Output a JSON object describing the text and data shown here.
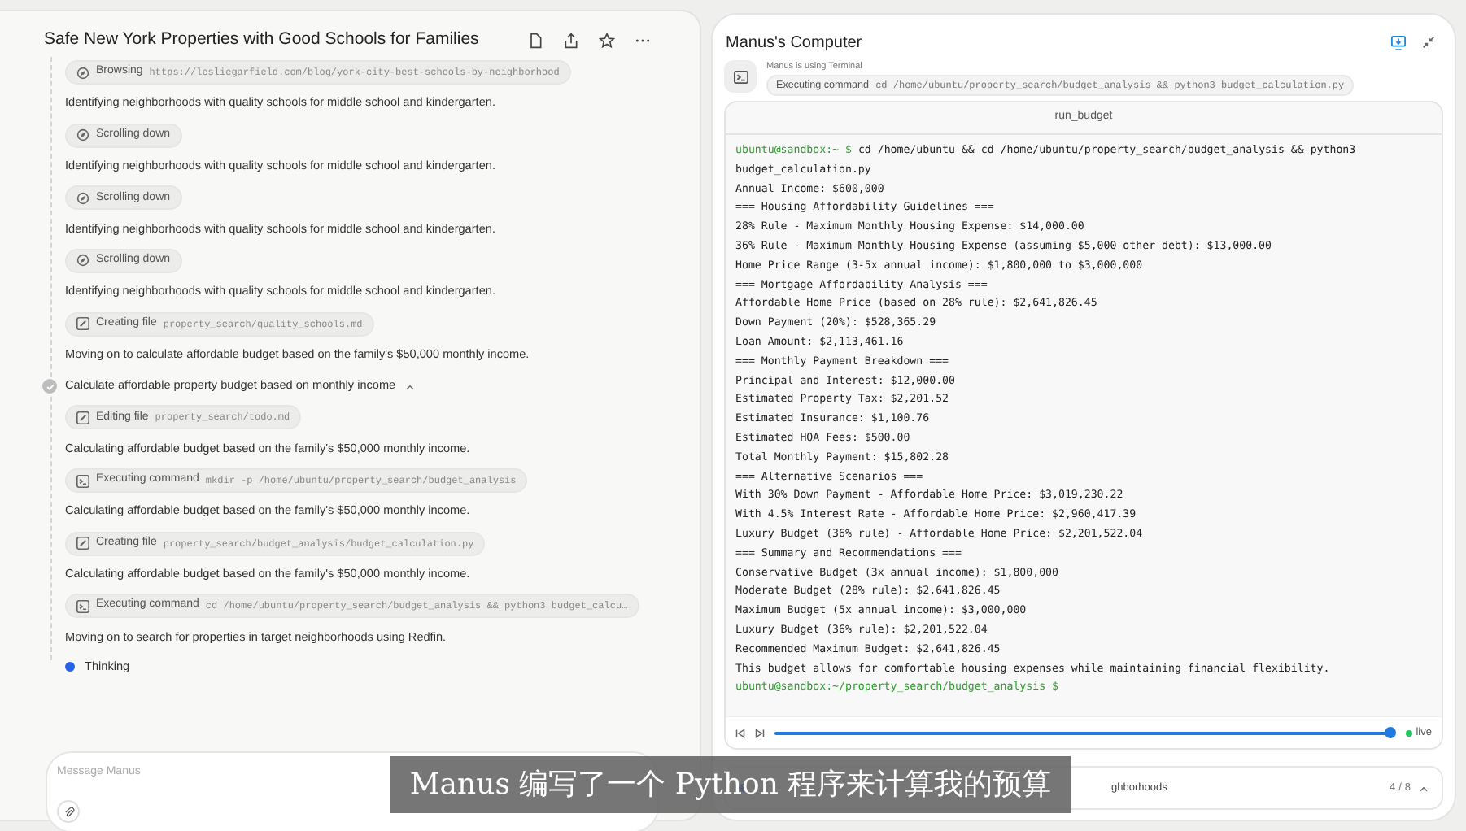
{
  "chat": {
    "title": "Safe New York Properties with Good Schools for Families",
    "log": [
      {
        "kind": "browser_chip",
        "label": "Browsing",
        "detail": "https://lesliegarfield.com/blog/york-city-best-schools-by-neighborhood"
      },
      {
        "kind": "text",
        "text": "Identifying neighborhoods with quality schools for middle school and kindergarten."
      },
      {
        "kind": "browser_chip",
        "label": "Scrolling down"
      },
      {
        "kind": "text",
        "text": "Identifying neighborhoods with quality schools for middle school and kindergarten."
      },
      {
        "kind": "browser_chip",
        "label": "Scrolling down"
      },
      {
        "kind": "text",
        "text": "Identifying neighborhoods with quality schools for middle school and kindergarten."
      },
      {
        "kind": "browser_chip",
        "label": "Scrolling down"
      },
      {
        "kind": "text",
        "text": "Identifying neighborhoods with quality schools for middle school and kindergarten."
      },
      {
        "kind": "file_chip",
        "label": "Creating file",
        "detail": "property_search/quality_schools.md"
      },
      {
        "kind": "text",
        "text": "Moving on to calculate affordable budget based on the family's $50,000 monthly income."
      },
      {
        "kind": "step",
        "text": "Calculate affordable property budget based on monthly income",
        "done": true,
        "expanded": true
      },
      {
        "kind": "file_chip",
        "label": "Editing file",
        "detail": "property_search/todo.md"
      },
      {
        "kind": "text",
        "text": "Calculating affordable budget based on the family's $50,000 monthly income."
      },
      {
        "kind": "terminal_chip",
        "label": "Executing command",
        "detail": "mkdir -p /home/ubuntu/property_search/budget_analysis"
      },
      {
        "kind": "text",
        "text": "Calculating affordable budget based on the family's $50,000 monthly income."
      },
      {
        "kind": "file_chip",
        "label": "Creating file",
        "detail": "property_search/budget_analysis/budget_calculation.py"
      },
      {
        "kind": "text",
        "text": "Calculating affordable budget based on the family's $50,000 monthly income."
      },
      {
        "kind": "terminal_chip",
        "label": "Executing command",
        "detail": "cd /home/ubuntu/property_search/budget_analysis && python3 budget_calcu…"
      },
      {
        "kind": "text",
        "text": "Moving on to search for properties in target neighborhoods using Redfin."
      },
      {
        "kind": "thinking",
        "text": "Thinking"
      }
    ],
    "input": {
      "placeholder": "Message Manus"
    }
  },
  "computer": {
    "title": "Manus's Computer",
    "status": "Manus is using Terminal",
    "action": {
      "label": "Executing command",
      "detail": "cd /home/ubuntu/property_search/budget_analysis && python3 budget_calculation.py"
    },
    "terminal": {
      "title": "run_budget",
      "lines": [
        {
          "kind": "prompt",
          "prompt": "ubuntu@sandbox:~ $",
          "command": "cd /home/ubuntu && cd /home/ubuntu/property_search/budget_analysis && python3 budget_calculation.py"
        },
        {
          "kind": "output",
          "text": "Annual Income: $600,000"
        },
        {
          "kind": "output",
          "text": "=== Housing Affordability Guidelines ==="
        },
        {
          "kind": "output",
          "text": "28% Rule - Maximum Monthly Housing Expense: $14,000.00"
        },
        {
          "kind": "output",
          "text": "36% Rule - Maximum Monthly Housing Expense (assuming $5,000 other debt): $13,000.00"
        },
        {
          "kind": "output",
          "text": "Home Price Range (3-5x annual income): $1,800,000 to $3,000,000"
        },
        {
          "kind": "output",
          "text": "=== Mortgage Affordability Analysis ==="
        },
        {
          "kind": "output",
          "text": "Affordable Home Price (based on 28% rule): $2,641,826.45"
        },
        {
          "kind": "output",
          "text": "Down Payment (20%): $528,365.29"
        },
        {
          "kind": "output",
          "text": "Loan Amount: $2,113,461.16"
        },
        {
          "kind": "output",
          "text": "=== Monthly Payment Breakdown ==="
        },
        {
          "kind": "output",
          "text": "Principal and Interest: $12,000.00"
        },
        {
          "kind": "output",
          "text": "Estimated Property Tax: $2,201.52"
        },
        {
          "kind": "output",
          "text": "Estimated Insurance: $1,100.76"
        },
        {
          "kind": "output",
          "text": "Estimated HOA Fees: $500.00"
        },
        {
          "kind": "output",
          "text": "Total Monthly Payment: $15,802.28"
        },
        {
          "kind": "output",
          "text": "=== Alternative Scenarios ==="
        },
        {
          "kind": "output",
          "text": "With 30% Down Payment - Affordable Home Price: $3,019,230.22"
        },
        {
          "kind": "output",
          "text": "With 4.5% Interest Rate - Affordable Home Price: $2,960,417.39"
        },
        {
          "kind": "output",
          "text": "Luxury Budget (36% rule) - Affordable Home Price: $2,201,522.04"
        },
        {
          "kind": "output",
          "text": "=== Summary and Recommendations ==="
        },
        {
          "kind": "output",
          "text": "Conservative Budget (3x annual income): $1,800,000"
        },
        {
          "kind": "output",
          "text": "Moderate Budget (28% rule): $2,641,826.45"
        },
        {
          "kind": "output",
          "text": "Maximum Budget (5x annual income): $3,000,000"
        },
        {
          "kind": "output",
          "text": "Luxury Budget (36% rule): $2,201,522.04"
        },
        {
          "kind": "output",
          "text": "Recommended Maximum Budget: $2,641,826.45"
        },
        {
          "kind": "output",
          "text": "This budget allows for comfortable housing expenses while maintaining financial flexibility."
        },
        {
          "kind": "prompt",
          "prompt": "ubuntu@sandbox:~/property_search/budget_analysis $"
        }
      ]
    },
    "playback": {
      "level": 1,
      "live": "live"
    },
    "task": {
      "text": "ghborhoods",
      "step": "4",
      "separator": "/",
      "total": "8"
    }
  },
  "subtitle": "Manus 编写了一个 Python 程序来计算我的预算"
}
